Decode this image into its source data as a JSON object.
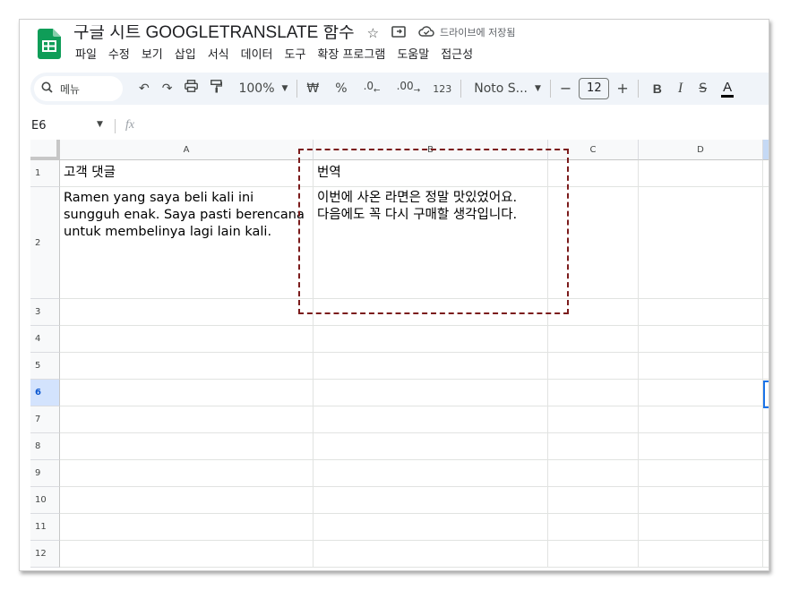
{
  "app": {
    "doc_title": "구글 시트 GOOGLETRANSLATE 함수",
    "save_status": "드라이브에 저장됨",
    "menu": [
      "파일",
      "수정",
      "보기",
      "삽입",
      "서식",
      "데이터",
      "도구",
      "확장 프로그램",
      "도움말",
      "접근성"
    ]
  },
  "toolbar": {
    "search_label": "메뉴",
    "zoom": "100%",
    "currency": "₩",
    "percent": "%",
    "dec_decrease": ".0",
    "dec_increase": ".00",
    "number_format": "123",
    "font": "Noto S...",
    "font_size": "12",
    "minus": "−",
    "plus": "+",
    "bold": "B",
    "italic": "I",
    "strike": "S",
    "text_color": "A"
  },
  "formula_bar": {
    "cell_ref": "E6",
    "fx": "fx"
  },
  "grid": {
    "columns": [
      "A",
      "B",
      "C",
      "D"
    ],
    "rows": [
      "1",
      "2",
      "3",
      "4",
      "5",
      "6",
      "7",
      "8",
      "9",
      "10",
      "11",
      "12"
    ],
    "active_row": "6",
    "cells": {
      "A1": "고객 댓글",
      "B1": "번역",
      "A2": "Ramen yang saya beli kali ini\nsungguh enak. Saya pasti berencana\nuntuk membelinya lagi lain kali.",
      "B2": "이번에 사온 라면은 정말 맛있었어요.\n다음에도 꼭 다시 구매할 생각입니다."
    }
  },
  "colors": {
    "accent": "#1a73e8",
    "highlight_border": "#7b1b1b",
    "logo_green": "#0f9d58"
  }
}
